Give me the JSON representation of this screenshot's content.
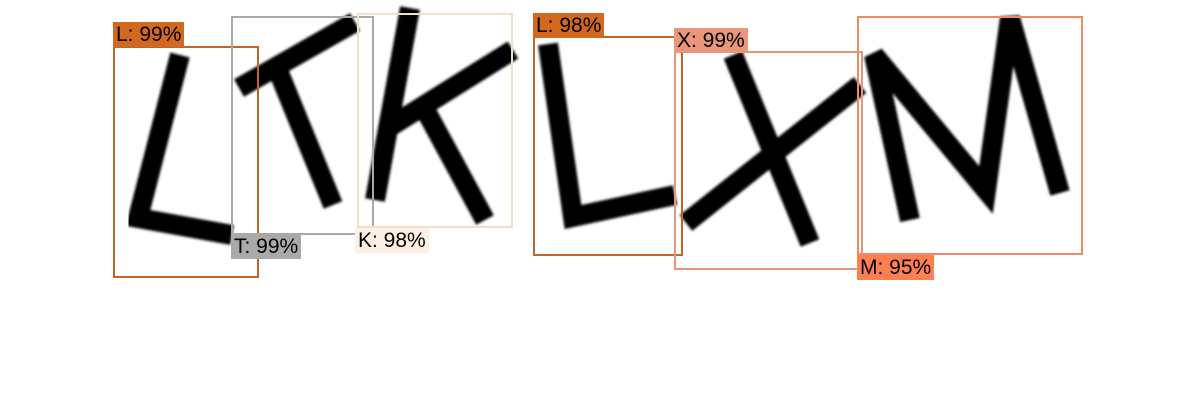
{
  "detections": [
    {
      "label": "L: 99%",
      "color": "#d2691e"
    },
    {
      "label": "T: 99%",
      "color": "#a9a9a9"
    },
    {
      "label": "K: 98%",
      "color": "#fdf0e2"
    },
    {
      "label": "L: 98%",
      "color": "#d2691e"
    },
    {
      "label": "X: 99%",
      "color": "#e9967a"
    },
    {
      "label": "M: 95%",
      "color": "#ff7f50"
    }
  ]
}
